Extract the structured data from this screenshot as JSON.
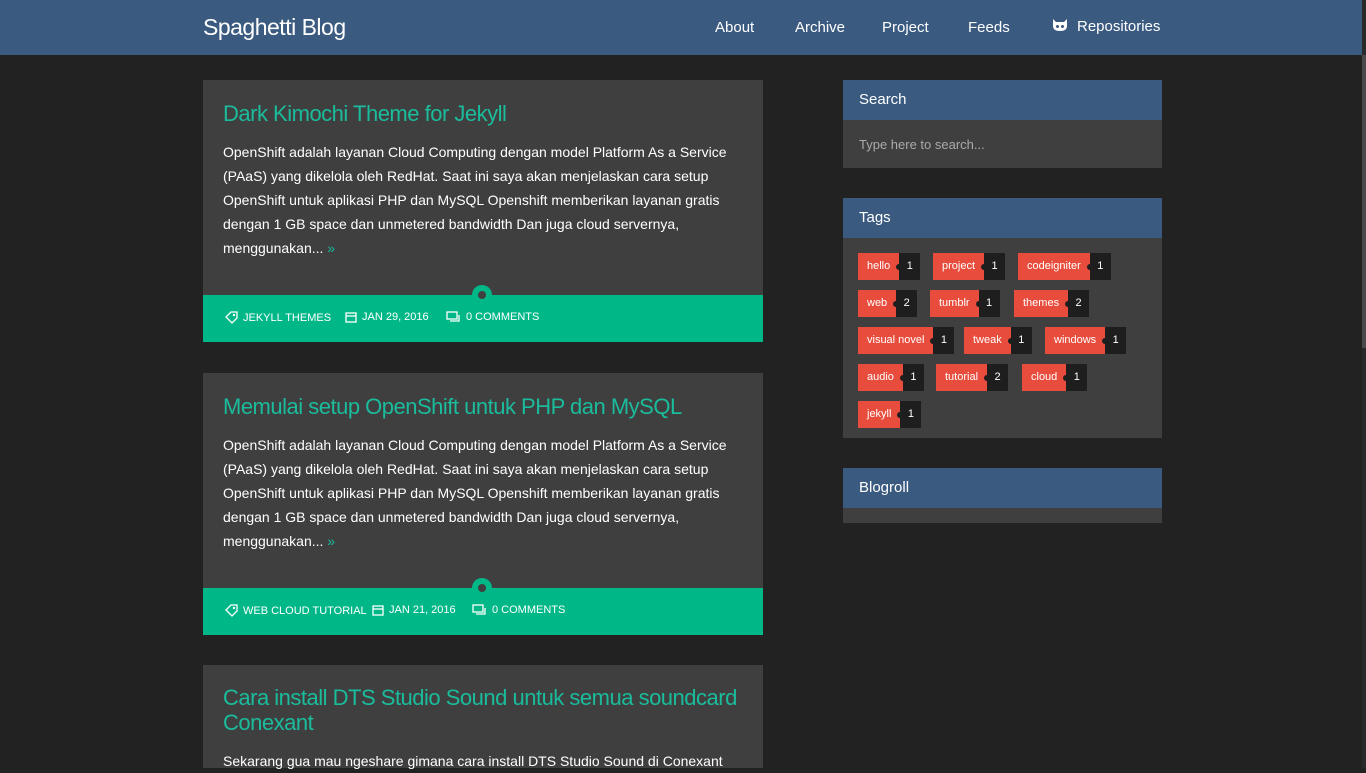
{
  "header": {
    "brand": "Spaghetti Blog",
    "nav": [
      {
        "label": "About"
      },
      {
        "label": "Archive"
      },
      {
        "label": "Project"
      },
      {
        "label": "Feeds"
      },
      {
        "label": "Repositories",
        "icon": "github-icon"
      }
    ]
  },
  "posts": [
    {
      "title": "Dark Kimochi Theme for Jekyll",
      "excerpt_lines": [
        "OpenShift adalah layanan Cloud Computing dengan model Platform As a Service",
        "(PAaS) yang dikelola oleh RedHat. Saat ini saya akan menjelaskan cara setup",
        "OpenShift untuk aplikasi PHP dan MySQL Openshift memberikan layanan gratis",
        "dengan 1 GB space dan unmetered bandwidth Dan juga cloud servernya,",
        "menggunakan..."
      ],
      "readmore": "»",
      "category": "JEKYLL THEMES",
      "date": "JAN 29, 2016",
      "comments": "0 COMMENTS"
    },
    {
      "title": "Memulai setup OpenShift untuk PHP dan MySQL",
      "excerpt_lines": [
        "OpenShift adalah layanan Cloud Computing dengan model Platform As a Service",
        "(PAaS) yang dikelola oleh RedHat. Saat ini saya akan menjelaskan cara setup",
        "OpenShift untuk aplikasi PHP dan MySQL Openshift memberikan layanan gratis",
        "dengan 1 GB space dan unmetered bandwidth Dan juga cloud servernya,",
        "menggunakan..."
      ],
      "readmore": "»",
      "category": "WEB CLOUD TUTORIAL",
      "date": "JAN 21, 2016",
      "comments": "0 COMMENTS"
    },
    {
      "title_lines": [
        "Cara install DTS Studio Sound untuk semua soundcard",
        "Conexant"
      ],
      "excerpt_first": "Sekarang gua mau ngeshare gimana cara install DTS Studio Sound di Conexant"
    }
  ],
  "sidebar": {
    "search": {
      "title": "Search",
      "placeholder": "Type here to search..."
    },
    "tags": {
      "title": "Tags",
      "items": [
        {
          "label": "hello",
          "count": "1"
        },
        {
          "label": "project",
          "count": "1"
        },
        {
          "label": "codeigniter",
          "count": "1"
        },
        {
          "label": "web",
          "count": "2"
        },
        {
          "label": "tumblr",
          "count": "1"
        },
        {
          "label": "themes",
          "count": "2"
        },
        {
          "label": "visual novel",
          "count": "1"
        },
        {
          "label": "tweak",
          "count": "1"
        },
        {
          "label": "windows",
          "count": "1"
        },
        {
          "label": "audio",
          "count": "1"
        },
        {
          "label": "tutorial",
          "count": "2"
        },
        {
          "label": "cloud",
          "count": "1"
        },
        {
          "label": "jekyll",
          "count": "1"
        }
      ]
    },
    "blogroll": {
      "title": "Blogroll"
    }
  },
  "colors": {
    "header": "#3a5a80",
    "accent": "#1abc9c",
    "meta_bar": "#00b887",
    "tag": "#e74c3c",
    "card": "#3f3f3f",
    "background": "#222222"
  }
}
